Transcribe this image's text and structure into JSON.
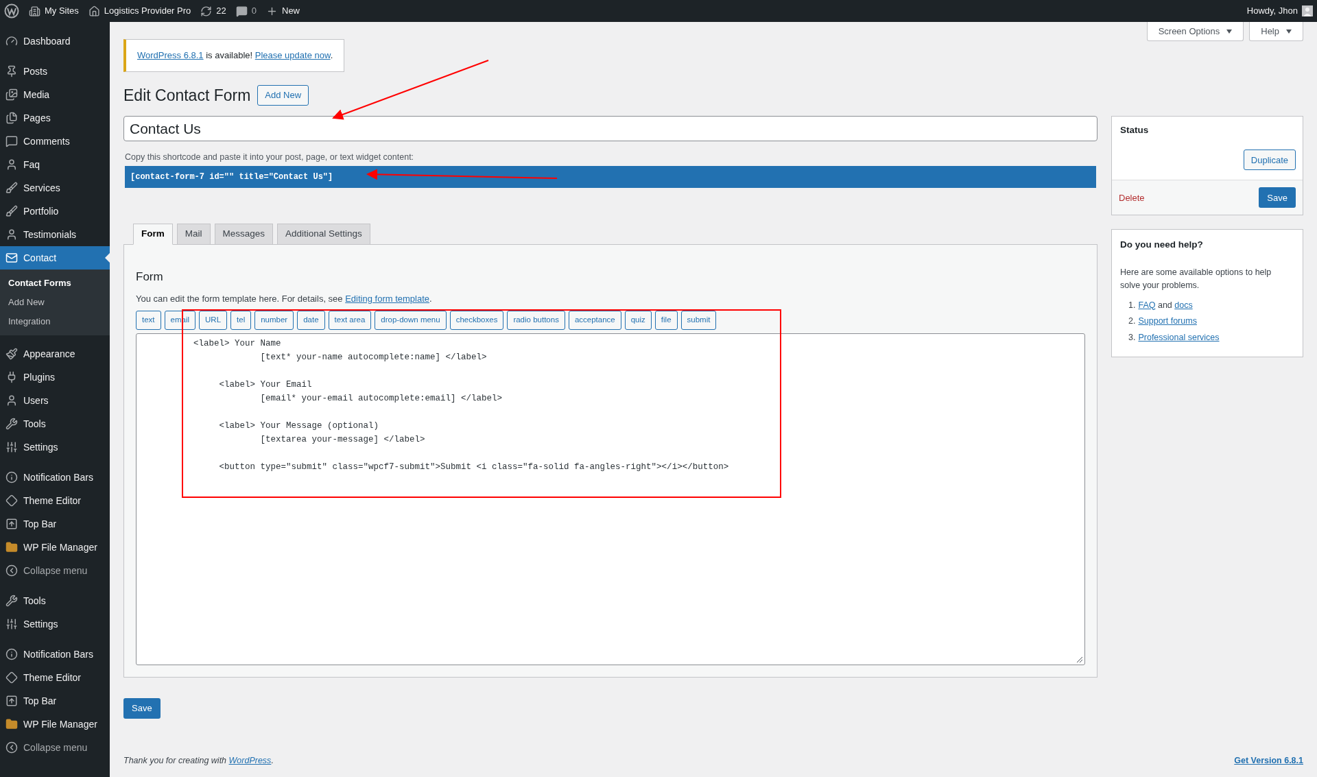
{
  "admin_bar": {
    "items": [
      {
        "label": "My Sites"
      },
      {
        "label": "Logistics Provider Pro"
      },
      {
        "label": "22"
      },
      {
        "label": "0"
      },
      {
        "label": "New"
      }
    ],
    "greeting": "Howdy, Jhon"
  },
  "sidebar": {
    "groups": [
      [
        {
          "label": "Dashboard",
          "kind": "item",
          "selected": false
        }
      ],
      [
        {
          "label": "Posts",
          "kind": "item",
          "selected": false
        },
        {
          "label": "Media",
          "kind": "item",
          "selected": false
        },
        {
          "label": "Pages",
          "kind": "item",
          "selected": false
        },
        {
          "label": "Comments",
          "kind": "item",
          "selected": false
        },
        {
          "label": "Faq",
          "kind": "item",
          "selected": false
        },
        {
          "label": "Services",
          "kind": "item",
          "selected": false
        },
        {
          "label": "Portfolio",
          "kind": "item",
          "selected": false
        },
        {
          "label": "Testimonials",
          "kind": "item",
          "selected": false
        },
        {
          "label": "Contact",
          "kind": "item",
          "selected": true,
          "submenu": [
            {
              "label": "Contact Forms",
              "selected": true
            },
            {
              "label": "Add New",
              "selected": false
            },
            {
              "label": "Integration",
              "selected": false
            }
          ]
        }
      ],
      [
        {
          "label": "Appearance",
          "kind": "item",
          "selected": false
        },
        {
          "label": "Plugins",
          "kind": "item",
          "selected": false
        },
        {
          "label": "Users",
          "kind": "item",
          "selected": false
        },
        {
          "label": "Tools",
          "kind": "item",
          "selected": false
        },
        {
          "label": "Settings",
          "kind": "item",
          "selected": false
        }
      ],
      [
        {
          "label": "Notification Bars",
          "kind": "item",
          "selected": false
        },
        {
          "label": "Theme Editor",
          "kind": "item",
          "selected": false
        },
        {
          "label": "Top Bar",
          "kind": "item",
          "selected": false
        },
        {
          "label": "WP File Manager",
          "kind": "item",
          "selected": false
        },
        {
          "label": "Collapse menu",
          "kind": "collapse",
          "selected": false
        }
      ],
      [
        {
          "label": "Tools",
          "kind": "item",
          "selected": false
        },
        {
          "label": "Settings",
          "kind": "item",
          "selected": false
        }
      ],
      [
        {
          "label": "Notification Bars",
          "kind": "item",
          "selected": false
        },
        {
          "label": "Theme Editor",
          "kind": "item",
          "selected": false
        },
        {
          "label": "Top Bar",
          "kind": "item",
          "selected": false
        },
        {
          "label": "WP File Manager",
          "kind": "item",
          "selected": false
        },
        {
          "label": "Collapse menu",
          "kind": "collapse",
          "selected": false
        }
      ]
    ]
  },
  "screen_meta": [
    "Screen Options",
    "Help"
  ],
  "notice": {
    "link": "WordPress 6.8.1",
    "text": " is available! ",
    "action": "Please update now",
    "end": "."
  },
  "page": {
    "title": "Edit Contact Form",
    "add_new": "Add New"
  },
  "form_title": {
    "value": "Contact Us"
  },
  "shortcode": {
    "hint": "Copy this shortcode and paste it into your post, page, or text widget content:",
    "code": "[contact-form-7 id=\"\" title=\"Contact Us\"]"
  },
  "tabs": [
    {
      "label": "Form",
      "selected": true
    },
    {
      "label": "Mail",
      "selected": false
    },
    {
      "label": "Messages",
      "selected": false
    },
    {
      "label": "Additional Settings",
      "selected": false
    }
  ],
  "form_panel": {
    "heading": "Form",
    "description": "You can edit the form template here. For details, see ",
    "link": "Editing form template",
    "end": ".",
    "tag_buttons": [
      "text",
      "email",
      "URL",
      "tel",
      "number",
      "date",
      "text area",
      "drop-down menu",
      "checkboxes",
      "radio buttons",
      "acceptance",
      "quiz",
      "file",
      "submit"
    ],
    "template": "          <label> Your Name\n                       [text* your-name autocomplete:name] </label>\n\n               <label> Your Email\n                       [email* your-email autocomplete:email] </label>\n\n               <label> Your Message (optional)\n                       [textarea your-message] </label>\n\n               <button type=\"submit\" class=\"wpcf7-submit\">Submit <i class=\"fa-solid fa-angles-right\"></i></button>"
  },
  "save_button": "Save",
  "status_box": {
    "title": "Status",
    "duplicate": "Duplicate",
    "delete": "Delete",
    "save": "Save"
  },
  "help_box": {
    "title": "Do you need help?",
    "text": "Here are some available options to help solve your problems.",
    "items": [
      {
        "number": "1.",
        "parts": [
          {
            "text": "FAQ",
            "link": true
          },
          {
            "text": " and ",
            "link": false
          },
          {
            "text": "docs",
            "link": true
          }
        ]
      },
      {
        "number": "2.",
        "parts": [
          {
            "text": "Support forums",
            "link": true
          }
        ]
      },
      {
        "number": "3.",
        "parts": [
          {
            "text": "Professional services",
            "link": true
          }
        ]
      }
    ]
  },
  "footer": {
    "thanks": "Thank you for creating with ",
    "link": "WordPress",
    "end": ".",
    "version": "Get Version 6.8.1"
  }
}
